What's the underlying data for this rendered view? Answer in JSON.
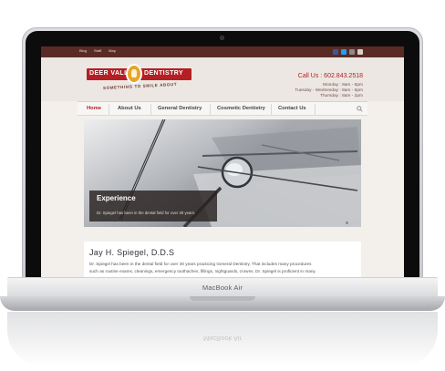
{
  "device": {
    "brand_label": "MacBook Air"
  },
  "site": {
    "topbar": {
      "links": [
        "Blog",
        "Staff",
        "Map"
      ],
      "social_colors": [
        "#3b5998",
        "#1da1f2",
        "#8b8b8b",
        "#d6d1cc"
      ]
    },
    "logo": {
      "left_word": "DEER VALLEY",
      "right_word": "DENTISTRY",
      "tagline": "SOMETHING TO SMILE ABOUT",
      "accent_red": "#b41f24",
      "accent_gold": "#e6a52a"
    },
    "contact": {
      "call_us": "Call Us : 602.843.2518",
      "hours": [
        "Monday : 8am - 6pm",
        "Tuesday - Wednesday : 8am - 5pm",
        "Thursday : 8am - 2pm"
      ]
    },
    "nav": {
      "items": [
        "Home",
        "About Us",
        "General Dentistry",
        "Cosmetic Dentistry",
        "Contact Us"
      ],
      "active": "Home",
      "search_icon": "search-icon"
    },
    "hero": {
      "title": "Experience",
      "text": "Dr. Spiegel has been in the dental field for over 30 years."
    },
    "content": {
      "doctor_name": "Jay H. Spiegel, D.D.S",
      "paragraph_lines": [
        "Dr. Spiegel has been in the dental field for over 30 years practicing General Dentistry. That includes many procedures",
        "such as routine exams, cleanings, emergency toothaches, fillings, nightguards, crowns. Dr. Spiegel is proficient in many"
      ]
    }
  }
}
